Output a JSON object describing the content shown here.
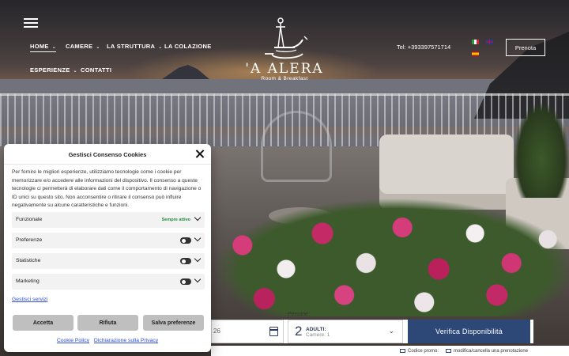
{
  "nav": {
    "items": [
      {
        "label": "HOME",
        "has_menu": true,
        "active": true
      },
      {
        "label": "CAMERE",
        "has_menu": true
      },
      {
        "label": "LA STRUTTURA",
        "has_menu": true
      },
      {
        "label": "LA COLAZIONE",
        "has_menu": false
      },
      {
        "label": "ESPERIENZE",
        "has_menu": true
      },
      {
        "label": "CONTATTI",
        "has_menu": false
      }
    ],
    "chevron": "⌄"
  },
  "logo": {
    "name": "'A ALERA",
    "subtitle": "Room & Breakfast"
  },
  "header": {
    "phone": "Tel: +393397571714",
    "book_label": "Prenota",
    "languages": [
      "it-flag",
      "en-flag",
      "es-flag"
    ]
  },
  "booking": {
    "persons_label": "Persone:",
    "date_value": "26",
    "guests_count": "2",
    "guests_label": "ADULTI:",
    "rooms_label": "Camere: 1",
    "verify_label": "Verifica Disponibilità",
    "promo_label": "Codice promo:",
    "modify_label": "modifica/cancella una prenotazione"
  },
  "cookie": {
    "title": "Gestisci Consenso Cookies",
    "text": "Per fornire le migliori esperienze, utilizziamo tecnologie come i cookie per memorizzare e/o accedere alle informazioni del dispositivo. Il consenso a queste tecnologie ci permetterà di elaborare dati come il comportamento di navigazione o ID unici su questo sito. Non acconsentire o ritirare il consenso può influire negativamente su alcune caratteristiche e funzioni.",
    "categories": [
      {
        "label": "Funzionale",
        "status": "Sempre attivo"
      },
      {
        "label": "Preferenze",
        "status": ""
      },
      {
        "label": "Statistiche",
        "status": ""
      },
      {
        "label": "Marketing",
        "status": ""
      }
    ],
    "manage_label": "Gestisci servizi",
    "accept_label": "Accetta",
    "deny_label": "Rifiuta",
    "save_label": "Salva preferenze",
    "policy_link": "Cookie Policy",
    "privacy_link": "Dichiarazione sulla Privacy"
  },
  "colors": {
    "accent": "#2d4777",
    "link": "#2b4dd6",
    "always_active": "#1f8a3a"
  }
}
